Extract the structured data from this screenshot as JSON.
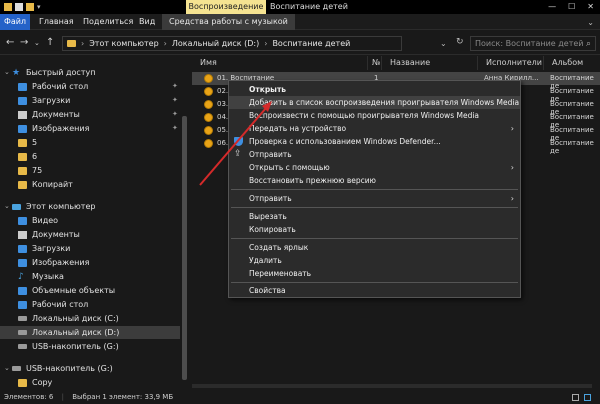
{
  "titlebar": {
    "contextual_tab": "Воспроизведение",
    "title": "Воспитание детей",
    "controls": [
      "—",
      "☐",
      "✕"
    ]
  },
  "ribbon": {
    "tabs": [
      "Файл",
      "Главная",
      "Поделиться",
      "Вид",
      "Средства работы с музыкой"
    ]
  },
  "address": {
    "path": [
      "Этот компьютер",
      "Локальный диск (D:)",
      "Воспитание детей"
    ],
    "search_placeholder": "Поиск: Воспитание детей"
  },
  "sidebar": {
    "quick_access": "Быстрый доступ",
    "quick_items": [
      "Рабочий стол",
      "Загрузки",
      "Документы",
      "Изображения",
      "5",
      "6",
      "75",
      "Копирайт"
    ],
    "this_pc": "Этот компьютер",
    "pc_items": [
      "Видео",
      "Документы",
      "Загрузки",
      "Изображения",
      "Музыка",
      "Объемные объекты",
      "Рабочий стол",
      "Локальный диск (C:)",
      "Локальный диск (D:)",
      "USB-накопитель (G:)"
    ],
    "usb": "USB-накопитель (G:)",
    "usb_items": [
      "Copy"
    ]
  },
  "columns": {
    "name": "Имя",
    "number": "№",
    "title": "Название",
    "artists": "Исполнители",
    "album": "Альбом"
  },
  "files": [
    {
      "name": "01. Воспитание",
      "num": "1",
      "artist": "Анна Кирилл...",
      "album": "Воспитание де"
    },
    {
      "name": "02.",
      "num": "",
      "artist": "",
      "album": "Воспитание де"
    },
    {
      "name": "03.",
      "num": "",
      "artist": "",
      "album": "Воспитание де"
    },
    {
      "name": "04.",
      "num": "",
      "artist": "",
      "album": "Воспитание де"
    },
    {
      "name": "05.",
      "num": "",
      "artist": "",
      "album": "Воспитание де"
    },
    {
      "name": "06.",
      "num": "",
      "artist": "",
      "album": "Воспитание де"
    }
  ],
  "context_menu": {
    "open": "Открыть",
    "add_to_playlist": "Добавить в список воспроизведения проигрывателя Windows Media",
    "play_with_wmp": "Воспроизвести с помощью проигрывателя Windows Media",
    "send_to_device": "Передать на устройство",
    "defender": "Проверка с использованием Windows Defender...",
    "share": "Отправить",
    "open_with": "Открыть с помощью",
    "restore": "Восстановить прежнюю версию",
    "send_to": "Отправить",
    "cut": "Вырезать",
    "copy": "Копировать",
    "create_shortcut": "Создать ярлык",
    "delete": "Удалить",
    "rename": "Переименовать",
    "properties": "Свойства"
  },
  "status": {
    "items_count": "Элементов: 6",
    "selected": "Выбран 1 элемент: 33,9 МБ"
  },
  "colors": {
    "background": "#191919",
    "file_tab": "#2462c8",
    "play_tab": "#f5e391",
    "folder": "#e7b948",
    "arrow": "#d42a2a"
  }
}
